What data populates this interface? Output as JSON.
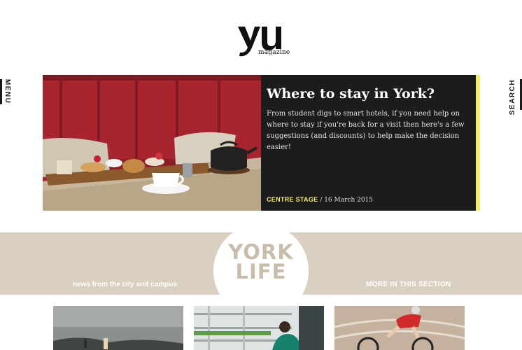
{
  "header": {
    "logo_mark": "yu",
    "logo_sub": "magazine"
  },
  "nav": {
    "menu_label": "MENU",
    "search_label": "SEARCH"
  },
  "hero": {
    "title": "Where to stay in York?",
    "text": "From student digs to smart hotels, if you need help on where to stay if you're back for a visit then here's a few suggestions (and discounts) to help make the decision easier!",
    "category": "CENTRE STAGE",
    "date": " / 16 March 2015",
    "accent_color": "#f2ec6e"
  },
  "section": {
    "title_line1": "YORK",
    "title_line2": "LIFE",
    "subtitle": "news from the city and campus",
    "more_link": "MORE IN THIS SECTION",
    "band_color": "#d9d0c1"
  },
  "cards": [
    {
      "image": "landscape-photo"
    },
    {
      "image": "lab-photo"
    },
    {
      "image": "cyclist-photo"
    }
  ]
}
